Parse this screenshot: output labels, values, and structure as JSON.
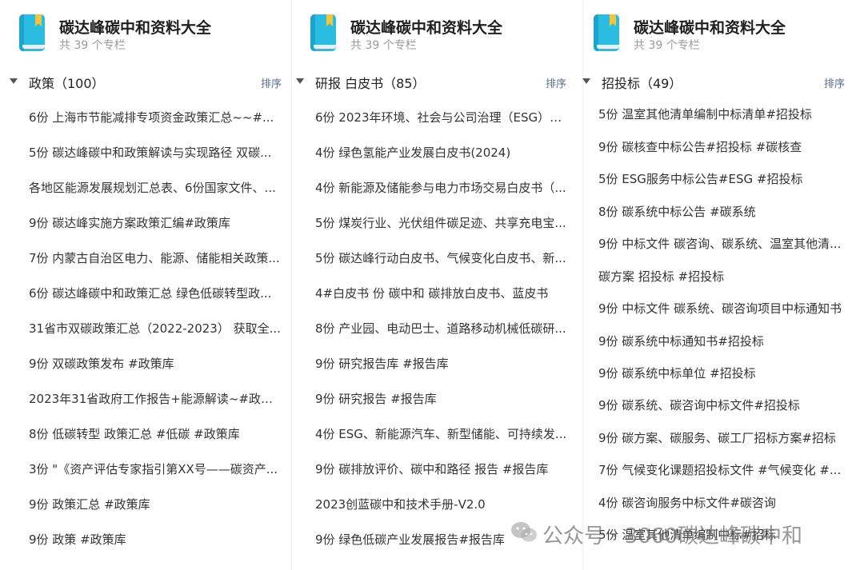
{
  "columns": [
    {
      "collection_title": "碳达峰碳中和资料大全",
      "collection_count": "共 39 个专栏",
      "section_title": "政策（100）",
      "sort_label": "排序",
      "items": [
        "6份 上海市节能减排专项资金政策汇总~~#...",
        "5份 碳达峰碳中和政策解读与实现路径 双碳...",
        "各地区能源发展规划汇总表、6份国家文件、...",
        "9份 碳达峰实施方案政策汇编#政策库",
        "7份 内蒙古自治区电力、能源、储能相关政策...",
        "6份 碳达峰碳中和政策汇总 绿色低碳转型政...",
        "31省市双碳政策汇总（2022-2023） 获取全...",
        "9份 双碳政策发布 #政策库",
        "2023年31省政府工作报告+能源解读~#政策库",
        "8份 低碳转型 政策汇总 #低碳 #政策库",
        "3份 \"《资产评估专家指引第XX号——碳资产...",
        "9份 政策汇总 #政策库",
        "9份 政策 #政策库"
      ]
    },
    {
      "collection_title": "碳达峰碳中和资料大全",
      "collection_count": "共 39 个专栏",
      "section_title": "研报 白皮书（85）",
      "sort_label": "排序",
      "items": [
        "6份 2023年环境、社会与公司治理（ESG）报...",
        "4份 绿色氢能产业发展白皮书(2024)",
        "4份 新能源及储能参与电力市场交易白皮书（...",
        "5份 煤炭行业、光伏组件碳足迹、共享充电宝...",
        "5份 碳达峰行动白皮书、气候变化白皮书、新...",
        "4#白皮书 份 碳中和 碳排放白皮书、蓝皮书",
        "8份 产业园、电动巴士、道路移动机械低碳研...",
        "9份 研究报告库 #报告库",
        "9份 研究报告 #报告库",
        "4份 ESG、新能源汽车、新型储能、可持续发...",
        "9份 碳排放评价、碳中和路径 报告 #报告库",
        "2023创蓝碳中和技术手册-V2.0",
        "9份 绿色低碳产业发展报告#报告库"
      ]
    },
    {
      "collection_title": "碳达峰碳中和资料大全",
      "collection_count": "共 39 个专栏",
      "section_title": "招投标（49）",
      "sort_label": "排序",
      "items": [
        "5份 温室其他清单编制中标清单#招投标",
        "9份 碳核查中标公告#招投标 #碳核查",
        "5份 ESG服务中标公告#ESG #招投标",
        "8份 碳系统中标公告 #碳系统",
        "9份 中标文件 碳咨询、碳系统、温室其他清...",
        "碳方案 招投标 #招投标",
        "9份 中标文件 碳系统、碳咨询项目中标通知书",
        "9份 碳系统中标通知书#招投标",
        "9份 碳系统中标单位 #招投标",
        "9份 碳系统、碳咨询中标文件#招投标",
        "9份 碳方案、碳服务、碳工厂招标方案#招标",
        "7份 气候变化课题招投标文件 #气候变化 #...",
        "4份 碳咨询服务中标文件#碳咨询",
        "5份 温室其他清单编制中标#招标"
      ]
    }
  ],
  "watermark": {
    "text": "公众号 · 3060碳达峰碳中和"
  },
  "colors": {
    "book_blue": "#2bbde1",
    "bookmark_yellow": "#f4c43d",
    "sort_link": "#576b95"
  }
}
